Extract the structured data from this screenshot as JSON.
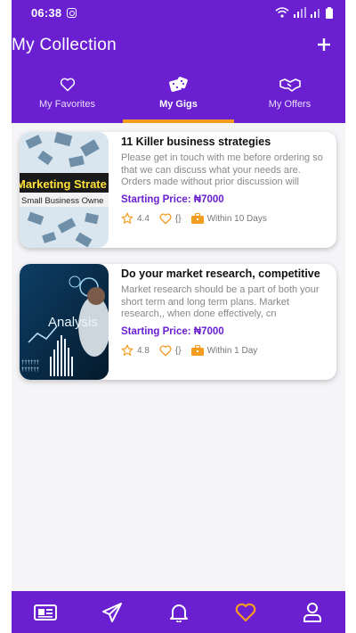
{
  "status": {
    "time": "06:38"
  },
  "header": {
    "title": "My Collection"
  },
  "tabs": [
    {
      "label": "My Favorites",
      "icon": "heart-outline-icon"
    },
    {
      "label": "My Gigs",
      "icon": "dice-icon",
      "active": true
    },
    {
      "label": "My Offers",
      "icon": "handshake-icon"
    }
  ],
  "gigs": [
    {
      "title": "11 Killer business strategies",
      "description": "Please get in touch with me before ordering so that we can discuss what your needs are. Orders made without prior discussion will",
      "price": "Starting Price: ₦7000",
      "rating": "4.4",
      "likes": "{}",
      "delivery": "Within 10 Days",
      "thumb_text_1": "Marketing Strate",
      "thumb_text_2": "Small Business Owne"
    },
    {
      "title": "Do your market research,  competitive",
      "description": "Market research should be a part of both your short term and long term plans. Market research,, when done effectively, cn",
      "price": "Starting Price: ₦7000",
      "rating": "4.8",
      "likes": "{}",
      "delivery": "Within 1 Day",
      "thumb_text_1": "Analysis"
    }
  ],
  "colors": {
    "primary": "#6a1fd1",
    "accent": "#f39c1f"
  }
}
